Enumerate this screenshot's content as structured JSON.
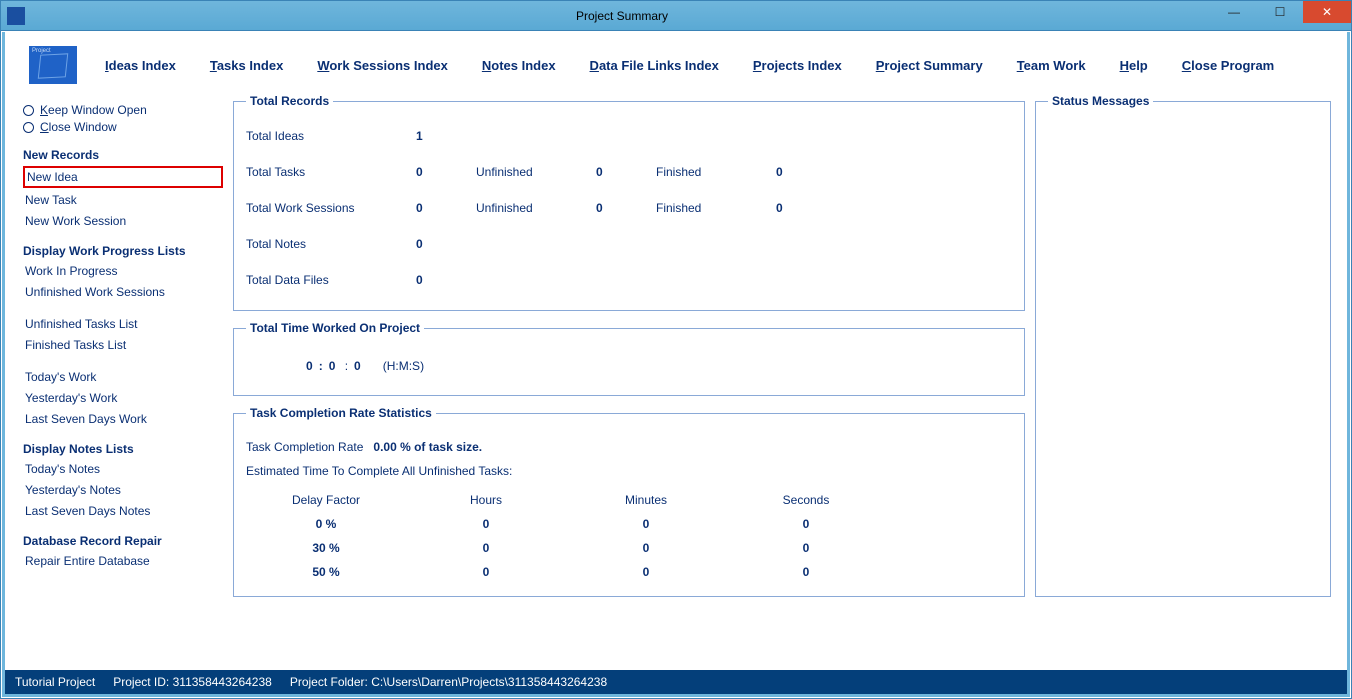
{
  "window": {
    "title": "Project Summary"
  },
  "menu": {
    "ideas": "deas Index",
    "tasks": "asks Index",
    "work": "ork Sessions Index",
    "notes": "otes Index",
    "data": "ata File Links Index",
    "projects": "rojects Index",
    "summary": "roject Summary",
    "team": "eam Work",
    "help": "elp",
    "close": "lose Program",
    "ideas_u": "I",
    "tasks_u": "T",
    "work_u": "W",
    "notes_u": "N",
    "data_u": "D",
    "projects_u": "P",
    "summary_u": "P",
    "team_u": "T",
    "help_u": "H",
    "close_u": "C"
  },
  "sidebar": {
    "keep": "eep Window Open",
    "closew": "lose Window",
    "keep_u": "K",
    "closew_u": "C",
    "heading_new": "New Records",
    "new_idea": "New Idea",
    "new_task": "New Task",
    "new_work": "New Work Session",
    "heading_progress": "Display Work Progress Lists",
    "wip": "Work In Progress",
    "unf_ws": "Unfinished Work Sessions",
    "unf_tasks": "Unfinished Tasks List",
    "fin_tasks": "Finished Tasks List",
    "today_work": "Today's Work",
    "yest_work": "Yesterday's Work",
    "seven_work": "Last Seven Days Work",
    "heading_notes": "Display Notes Lists",
    "today_notes": "Today's Notes",
    "yest_notes": "Yesterday's Notes",
    "seven_notes": "Last Seven Days Notes",
    "heading_repair": "Database Record Repair",
    "repair": "Repair Entire Database"
  },
  "records": {
    "legend": "Total Records",
    "ideas_label": "Total Ideas",
    "ideas_val": "1",
    "tasks_label": "Total Tasks",
    "tasks_val": "0",
    "unfinished_label": "Unfinished",
    "tasks_unf": "0",
    "finished_label": "Finished",
    "tasks_fin": "0",
    "ws_label": "Total Work Sessions",
    "ws_val": "0",
    "ws_unf": "0",
    "ws_fin": "0",
    "notes_label": "Total Notes",
    "notes_val": "0",
    "files_label": "Total Data Files",
    "files_val": "0"
  },
  "time": {
    "legend": "Total Time Worked On Project",
    "h": "0",
    "m": "0",
    "s": "0",
    "suffix": "(H:M:S)"
  },
  "stats": {
    "legend": "Task Completion Rate Statistics",
    "rate_label": "Task Completion Rate",
    "rate_value": "0.00 % of task size.",
    "est_label": "Estimated Time To Complete All Unfinished Tasks:",
    "cols": {
      "delay": "Delay Factor",
      "hours": "Hours",
      "minutes": "Minutes",
      "seconds": "Seconds"
    },
    "rows": [
      {
        "delay": "0 %",
        "h": "0",
        "m": "0",
        "s": "0"
      },
      {
        "delay": "30 %",
        "h": "0",
        "m": "0",
        "s": "0"
      },
      {
        "delay": "50 %",
        "h": "0",
        "m": "0",
        "s": "0"
      }
    ]
  },
  "status_panel": {
    "legend": "Status Messages"
  },
  "statusbar": {
    "project": "Tutorial Project",
    "id_label": "Project ID: ",
    "id_value": "311358443264238",
    "folder_label": "Project Folder: ",
    "folder_value": "C:\\Users\\Darren\\Projects\\311358443264238"
  }
}
